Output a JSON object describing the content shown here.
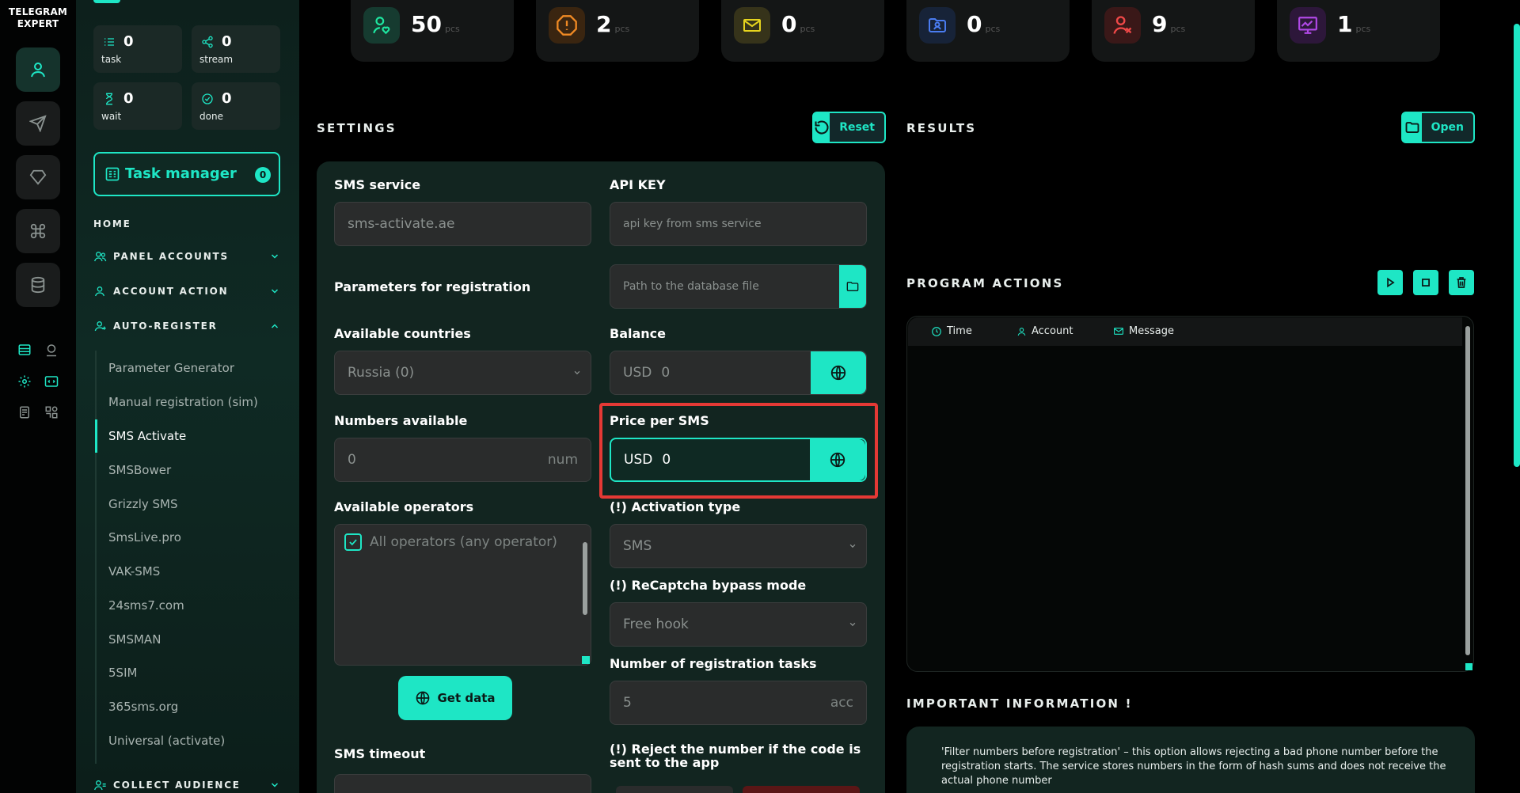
{
  "brand": {
    "line1": "TELEGRAM",
    "line2": "EXPERT"
  },
  "rail": {
    "buttons": [
      "user-icon",
      "send-icon",
      "diamond-icon",
      "command-icon",
      "database-icon"
    ],
    "small_icons": [
      "list-icon",
      "location-icon",
      "settings-icon",
      "code-icon",
      "doc-icon",
      "grid-icon"
    ]
  },
  "menu_stats": [
    {
      "value": "0",
      "label": "task"
    },
    {
      "value": "0",
      "label": "stream"
    },
    {
      "value": "0",
      "label": "wait"
    },
    {
      "value": "0",
      "label": "done"
    }
  ],
  "task_manager": {
    "label": "Task manager",
    "count": "0"
  },
  "nav": {
    "home": "HOME",
    "panel_accounts": "PANEL ACCOUNTS",
    "account_action": "ACCOUNT ACTION",
    "auto_register": "AUTO-REGISTER",
    "collect_audience": "COLLECT AUDIENCE",
    "sub_items": [
      "Parameter Generator",
      "Manual registration (sim)",
      "SMS Activate",
      "SMSBower",
      "Grizzly SMS",
      "SmsLive.pro",
      "VAK-SMS",
      "24sms7.com",
      "SMSMAN",
      "5SIM",
      "365sms.org",
      "Universal (activate)"
    ],
    "active_item": "SMS Activate"
  },
  "stat_cards": [
    {
      "value": "50",
      "unit": "pcs",
      "icon": "user-heart-icon",
      "color": "#1ee6a0"
    },
    {
      "value": "2",
      "unit": "pcs",
      "icon": "alert-octagon-icon",
      "color": "#f08a24"
    },
    {
      "value": "0",
      "unit": "pcs",
      "icon": "mail-icon",
      "color": "#e6d41e"
    },
    {
      "value": "0",
      "unit": "pcs",
      "icon": "folder-user-icon",
      "color": "#4a7cf0"
    },
    {
      "value": "9",
      "unit": "pcs",
      "icon": "user-x-icon",
      "color": "#f04848"
    },
    {
      "value": "1",
      "unit": "pcs",
      "icon": "chart-board-icon",
      "color": "#b048e6"
    }
  ],
  "settings": {
    "title": "SETTINGS",
    "reset_label": "Reset",
    "sms_service_label": "SMS service",
    "sms_service_value": "sms-activate.ae",
    "api_key_label": "API KEY",
    "api_key_placeholder": "api key from sms service",
    "db_path_placeholder": "Path to the database file",
    "params_label": "Parameters for registration",
    "countries_label": "Available countries",
    "countries_value": "Russia (0)",
    "balance_label": "Balance",
    "balance_currency": "USD",
    "balance_value": "0",
    "numbers_label": "Numbers available",
    "numbers_value": "0",
    "numbers_unit": "num",
    "price_label": "Price per SMS",
    "price_currency": "USD",
    "price_value": "0",
    "operators_label": "Available operators",
    "operators_option": "All operators (any operator)",
    "activation_label": "(!) Activation type",
    "activation_value": "SMS",
    "recaptcha_label": "(!) ReCaptcha bypass mode",
    "recaptcha_value": "Free hook",
    "tasks_label": "Number of registration tasks",
    "tasks_value": "5",
    "tasks_unit": "acc",
    "get_data_label": "Get data",
    "sms_timeout_label": "SMS timeout",
    "reject_label": "(!) Reject the number if the code is sent to the app"
  },
  "results": {
    "title": "RESULTS",
    "open_label": "Open"
  },
  "program_actions": {
    "title": "PROGRAM ACTIONS",
    "columns": [
      "Time",
      "Account",
      "Message"
    ]
  },
  "important": {
    "title": "IMPORTANT INFORMATION !",
    "text": "'Filter numbers before registration' – this option allows rejecting a bad phone number before the registration starts. The service stores numbers in the form of hash sums and does not receive the actual phone number"
  },
  "colors": {
    "accent": "#1ee6c5",
    "highlight": "#e53935"
  }
}
